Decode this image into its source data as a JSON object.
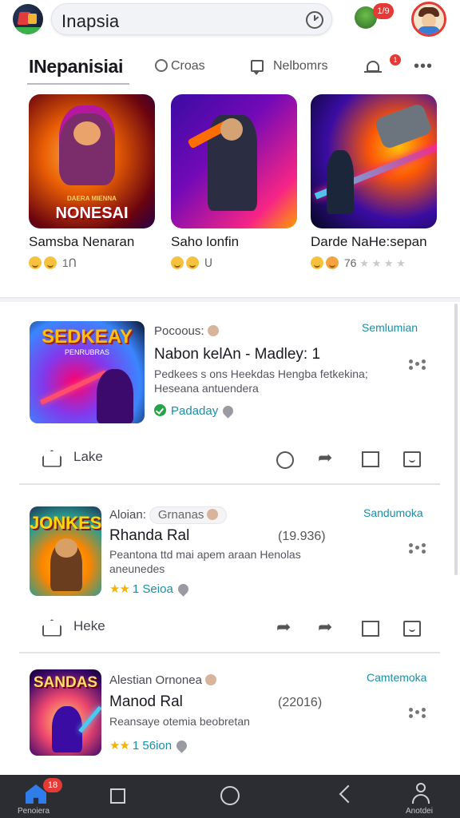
{
  "header": {
    "search_value": "Inapsia",
    "notification_badge": "1/9"
  },
  "tabs": {
    "active_label": "INepanisiai",
    "tab2_label": "Croas",
    "tab3_label": "Nelbomrs",
    "bell_badge": "1",
    "more_label": "•••"
  },
  "featured": [
    {
      "name": "Samsba Nenaran",
      "rating_text": "1Ո",
      "art_logo": "NONESAI",
      "art_logo_sub": "DAERA MIENNA"
    },
    {
      "name": "Saho lonfin",
      "rating_text": "Ս"
    },
    {
      "name": "Darde NaHe:sepan",
      "rating_text": "76"
    }
  ],
  "posts": [
    {
      "source": "Pocoous:",
      "subscribe": "Semlumian",
      "title": "Nabon kelAn - Madley: 1",
      "description": "Pedkees s ons Heekdas Hengba fetkekina; Heseana antuendera",
      "meta": "Padaday",
      "meta_color": "#1f9d55",
      "thumb_text": "SEDKEAY",
      "thumb_sub": "PENRUBRAS",
      "actions": {
        "like_label": "Lake"
      }
    },
    {
      "source": "Aloian:",
      "source_pill": "Grnanas",
      "subscribe": "Sandumoka",
      "title": "Rhanda Ral",
      "count": "(19.936)",
      "description": "Peantona ttd mai apem araan Henolas aneunedes",
      "meta": "1 Seioa",
      "meta_color": "#1b8fa6",
      "thumb_text": "JONKES",
      "actions": {
        "like_label": "Heke"
      }
    },
    {
      "source": "Alestian Ornonea",
      "subscribe": "Camtemoka",
      "title": "Manod Ral",
      "count": "(22016)",
      "description": "Reansaye otemia beobretan",
      "meta": "1 56ion",
      "meta_color": "#1b8fa6",
      "thumb_text": "SANDAS"
    }
  ],
  "bottom_nav": {
    "home_label": "Penoiera",
    "home_badge": "18",
    "profile_label": "Anotdei"
  },
  "colors": {
    "accent": "#1b8fa6",
    "badge": "#e53935",
    "nav_bg": "#2b2d32",
    "home_active": "#2f7dea"
  },
  "icons": [
    "app-logo",
    "clock-icon",
    "circle-icon",
    "chat-icon",
    "bell-icon",
    "more-icon",
    "home-icon",
    "share-icon",
    "bookmark-icon",
    "flag-icon",
    "square-icon",
    "back-icon",
    "profile-icon"
  ]
}
